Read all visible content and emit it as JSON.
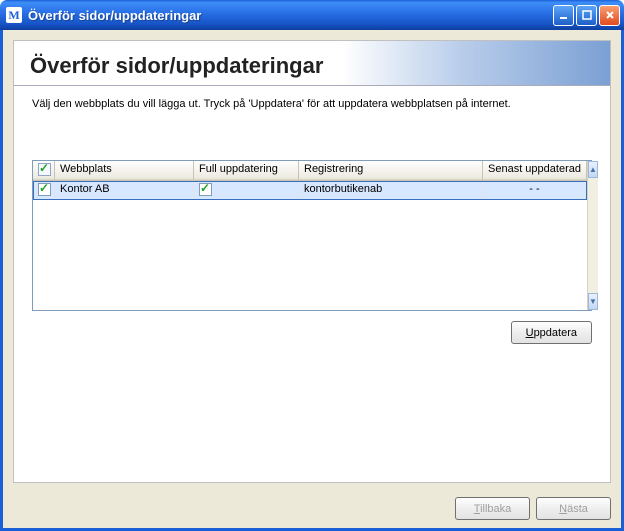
{
  "window": {
    "app_letter": "M",
    "title": "Överför sidor/uppdateringar"
  },
  "page": {
    "heading": "Överför sidor/uppdateringar",
    "instruction": "Välj den webbplats du vill lägga ut.  Tryck på 'Uppdatera' för att uppdatera webbplatsen på internet."
  },
  "grid": {
    "headers": {
      "webbplats": "Webbplats",
      "full_uppdatering": "Full uppdatering",
      "registrering": "Registrering",
      "senast_uppdaterad": "Senast uppdaterad"
    },
    "rows": [
      {
        "checked": true,
        "webbplats": "Kontor AB",
        "full_uppdatering_checked": true,
        "registrering": "kontorbutikenab",
        "senast_uppdaterad": "- -"
      }
    ]
  },
  "buttons": {
    "uppdatera": "Uppdatera",
    "tillbaka": "Tillbaka",
    "nasta": "Nästa"
  }
}
